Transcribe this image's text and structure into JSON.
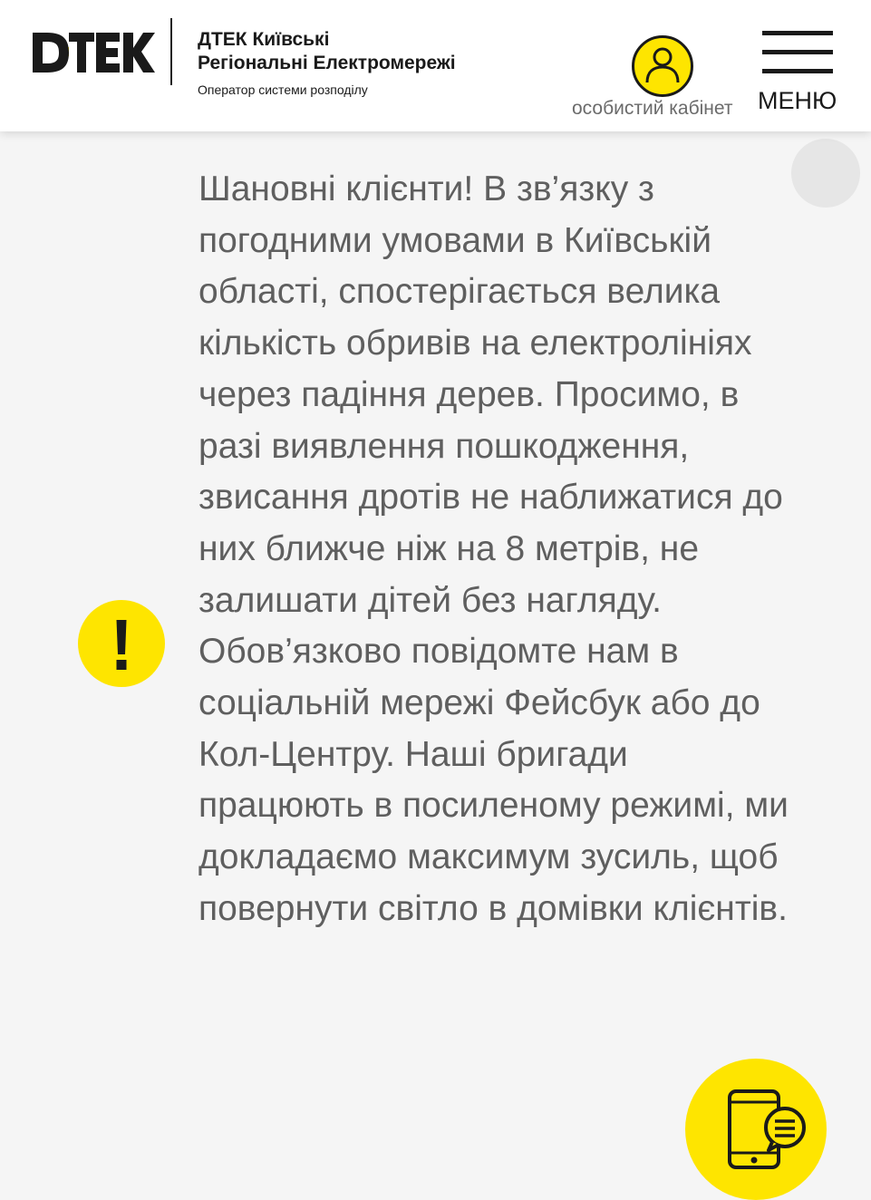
{
  "header": {
    "logo_text": "D.TEK",
    "company_name_line1": "ДТЕК Київські",
    "company_name_line2": "Регіональні Електромережі",
    "company_subtitle": "Оператор системи розподілу",
    "cabinet_label": "особистий кабінет",
    "menu_label": "МЕНЮ"
  },
  "notice": {
    "text": "Шановні клієнти! В зв’язку з погодними умовами в Київській області, спостерігається велика кількість обривів на електролініях через падіння дерев. Просимо, в разі виявлення пошкодження, звисання дротів не наближатися до них ближче ніж на 8 метрів, не залишати дітей без нагляду. Обов’язково повідомте нам в соціальній мережі Фейсбук або до Кол-Центру. Наші бригади працюють в посиленому режимі, ми докладаємо максимум зусиль, щоб повернути світло в домівки клієнтів."
  },
  "icons": {
    "logo": "dtek-logo",
    "cabinet": "user-icon",
    "menu": "hamburger-icon",
    "close": "close-icon",
    "alert": "exclamation-icon",
    "chat": "phone-chat-icon"
  },
  "colors": {
    "brand_yellow": "#fee500",
    "text_dark": "#1a1a1a",
    "text_gray": "#5f5f5f",
    "background": "#f5f5f5"
  }
}
